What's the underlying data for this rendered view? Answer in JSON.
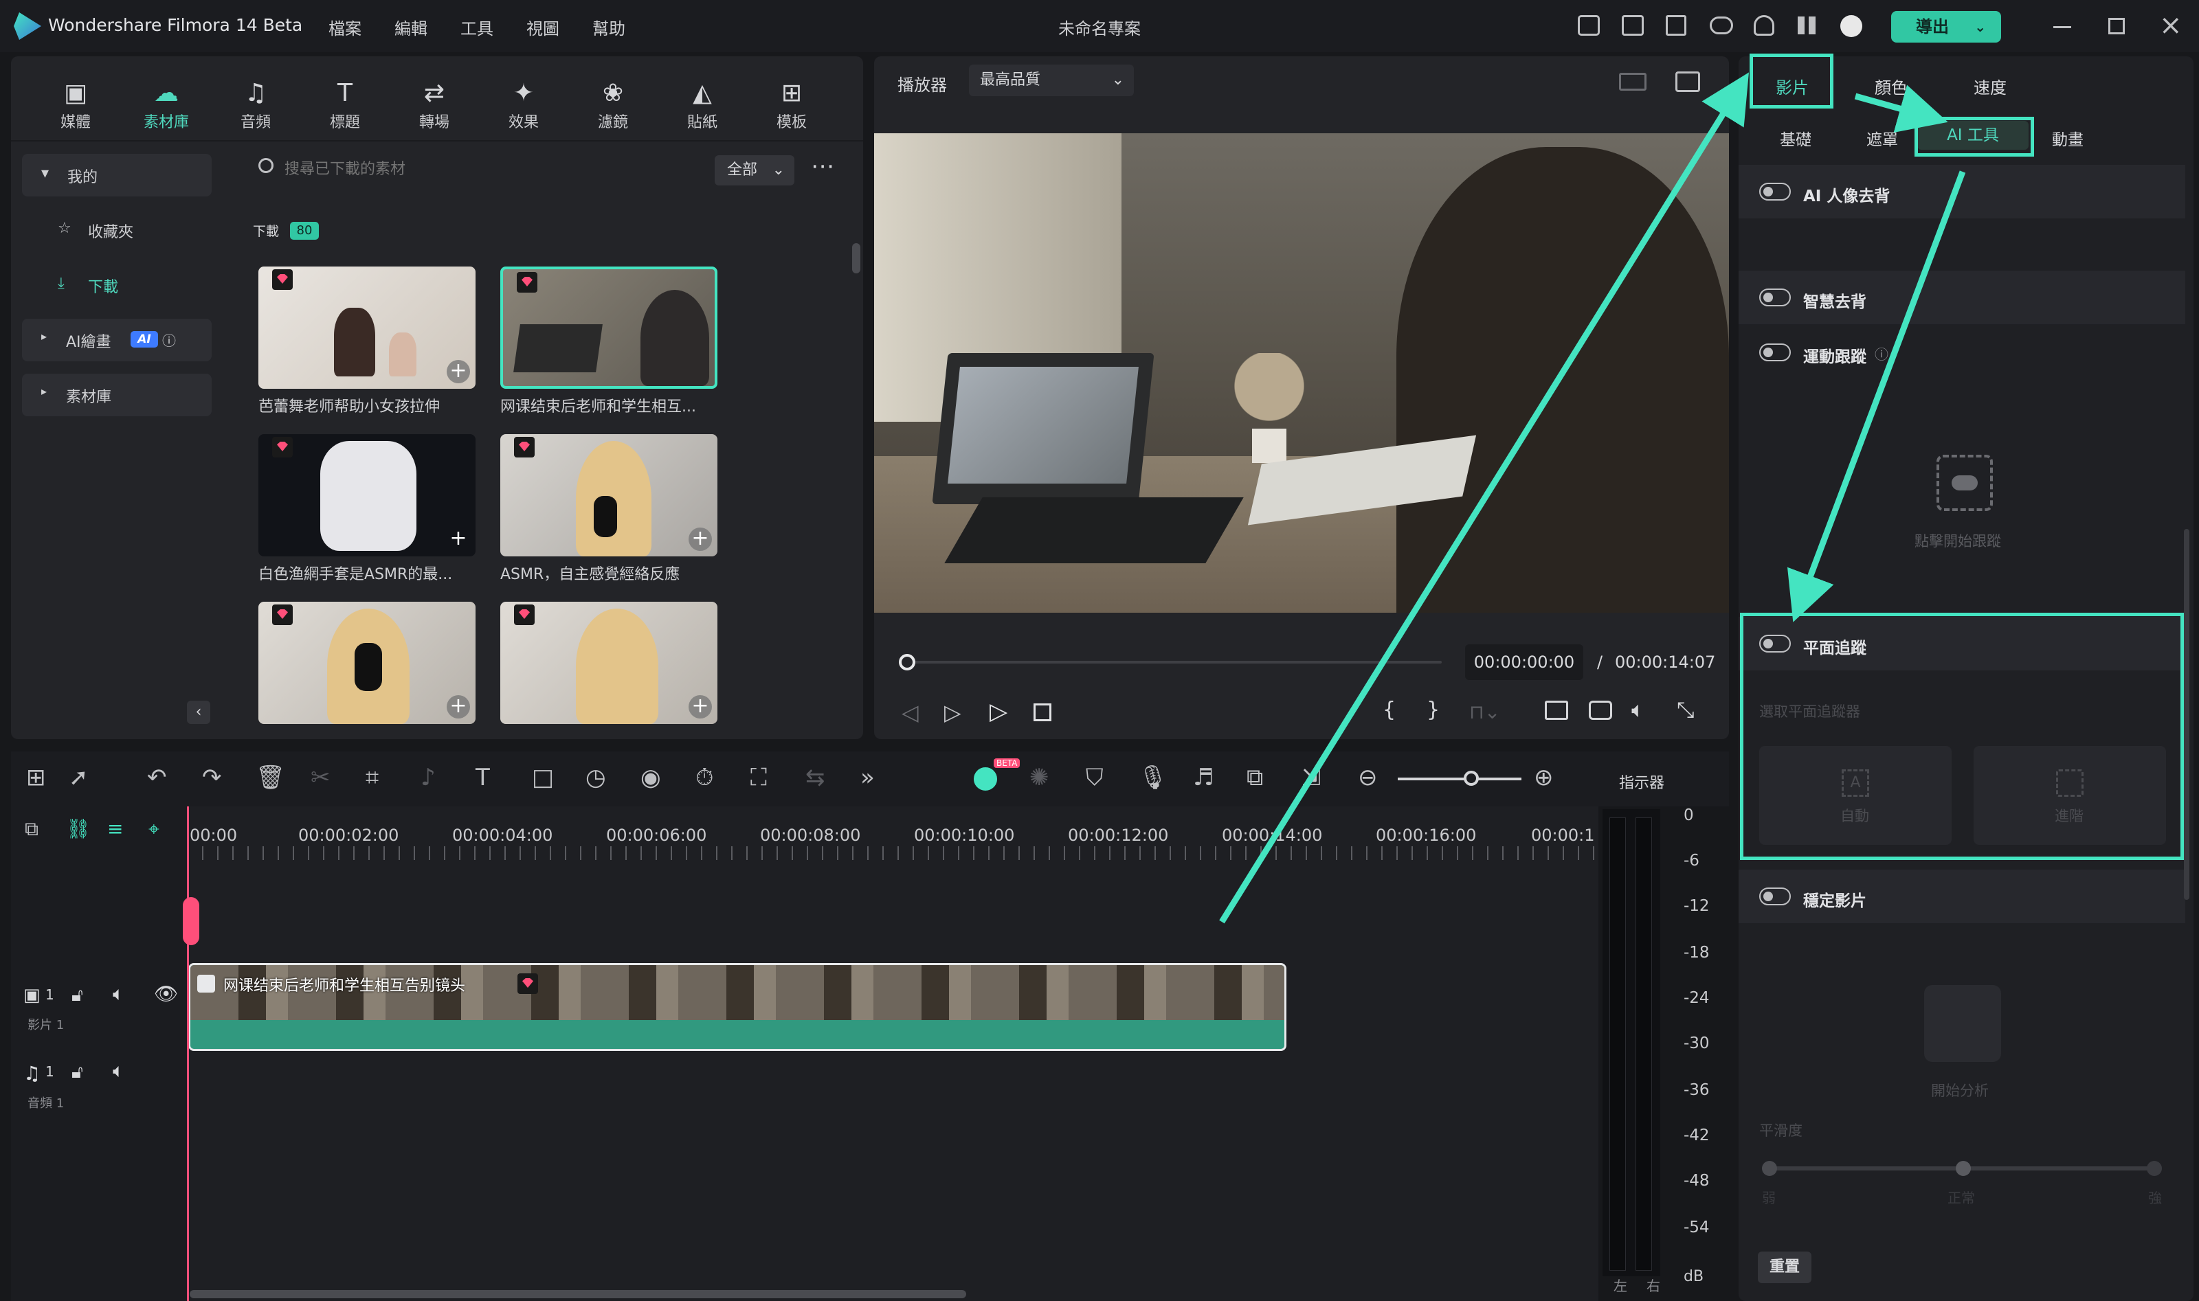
{
  "app": {
    "title": "Wondershare Filmora 14 Beta",
    "project": "未命名專案",
    "export": "導出"
  },
  "menu": [
    "檔案",
    "編輯",
    "工具",
    "視圖",
    "幫助"
  ],
  "toolbar_tabs": [
    {
      "label": "媒體",
      "icon": "media-icon"
    },
    {
      "label": "素材庫",
      "icon": "stock-icon"
    },
    {
      "label": "音頻",
      "icon": "audio-icon"
    },
    {
      "label": "標題",
      "icon": "title-icon"
    },
    {
      "label": "轉場",
      "icon": "transition-icon"
    },
    {
      "label": "效果",
      "icon": "effects-icon"
    },
    {
      "label": "濾鏡",
      "icon": "filters-icon"
    },
    {
      "label": "貼紙",
      "icon": "stickers-icon"
    },
    {
      "label": "模板",
      "icon": "templates-icon"
    }
  ],
  "sidebar": {
    "mine": "我的",
    "favorites": "收藏夾",
    "download": "下載",
    "ai_art": "AI繪畫",
    "ai_badge": "AI",
    "library": "素材庫"
  },
  "library": {
    "search_placeholder": "搜尋已下載的素材",
    "filter": "全部",
    "section": "下載",
    "count": "80",
    "items": [
      "芭蕾舞老师帮助小女孩拉伸",
      "网课结束后老师和学生相互...",
      "白色渔網手套是ASMR的最...",
      "ASMR，自主感覺經絡反應"
    ]
  },
  "player": {
    "label": "播放器",
    "quality": "最高品質",
    "current": "00:00:00:00",
    "sep": "/",
    "total": "00:00:14:07"
  },
  "right_panel": {
    "tabs": [
      "影片",
      "顏色",
      "速度"
    ],
    "subtabs": [
      "基礎",
      "遮罩",
      "AI 工具",
      "動畫"
    ],
    "ai_portrait": "AI 人像去背",
    "smart_cutout": "智慧去背",
    "motion_tracking": "運動跟蹤",
    "click_start_tracking": "點擊開始跟蹤",
    "planar_tracking": "平面追蹤",
    "select_planar": "選取平面追蹤器",
    "auto": "自動",
    "advanced": "進階",
    "stabilize": "穩定影片",
    "start_analysis": "開始分析",
    "smoothness": "平滑度",
    "low": "弱",
    "normal": "正常",
    "high": "強",
    "reset": "重置"
  },
  "timeline": {
    "ruler": [
      "00:00",
      "00:00:02:00",
      "00:00:04:00",
      "00:00:06:00",
      "00:00:08:00",
      "00:00:10:00",
      "00:00:12:00",
      "00:00:14:00",
      "00:00:16:00",
      "00:00:1"
    ],
    "clip_title": "网课结束后老师和学生相互告别镜头",
    "video_track": "影片 1",
    "audio_track": "音頻 1",
    "track_num": "1",
    "indicator": "指示器",
    "beta": "BETA"
  },
  "meter": {
    "levels": [
      "0",
      "-6",
      "-12",
      "-18",
      "-24",
      "-30",
      "-36",
      "-42",
      "-48",
      "-54"
    ],
    "left": "左",
    "right": "右",
    "unit": "dB"
  },
  "colors": {
    "accent": "#44e4c1",
    "export_bg": "#31c7a3"
  }
}
